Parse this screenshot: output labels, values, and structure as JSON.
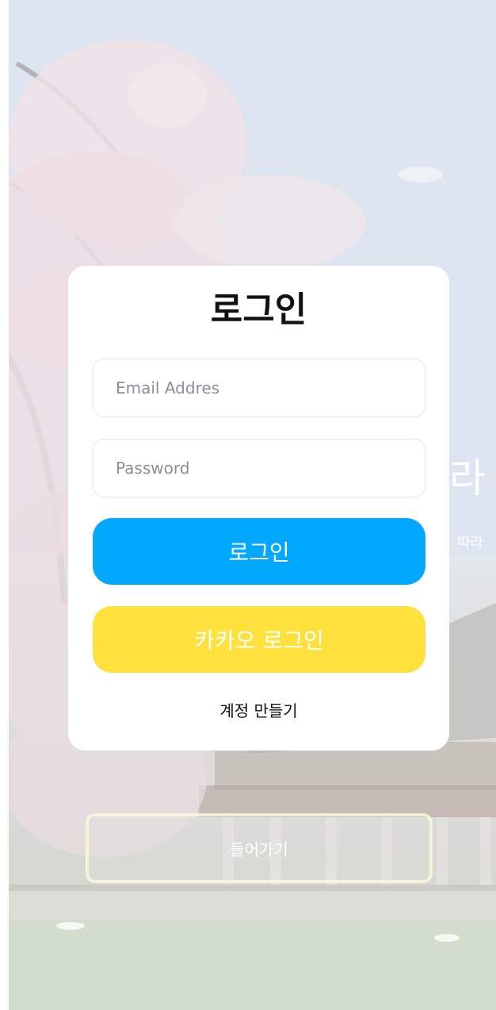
{
  "hero": {
    "title": "라",
    "subtitle": "따라"
  },
  "login_card": {
    "title": "로그인",
    "email_placeholder": "Email Addres",
    "password_placeholder": "Password",
    "login_button": "로그인",
    "kakao_button": "카카오 로그인",
    "signup_link": "계정 만들기"
  },
  "enter_button": "들어가기",
  "colors": {
    "login_button": "#00a8ff",
    "kakao_button": "#ffe13d",
    "card_background": "#ffffff"
  }
}
